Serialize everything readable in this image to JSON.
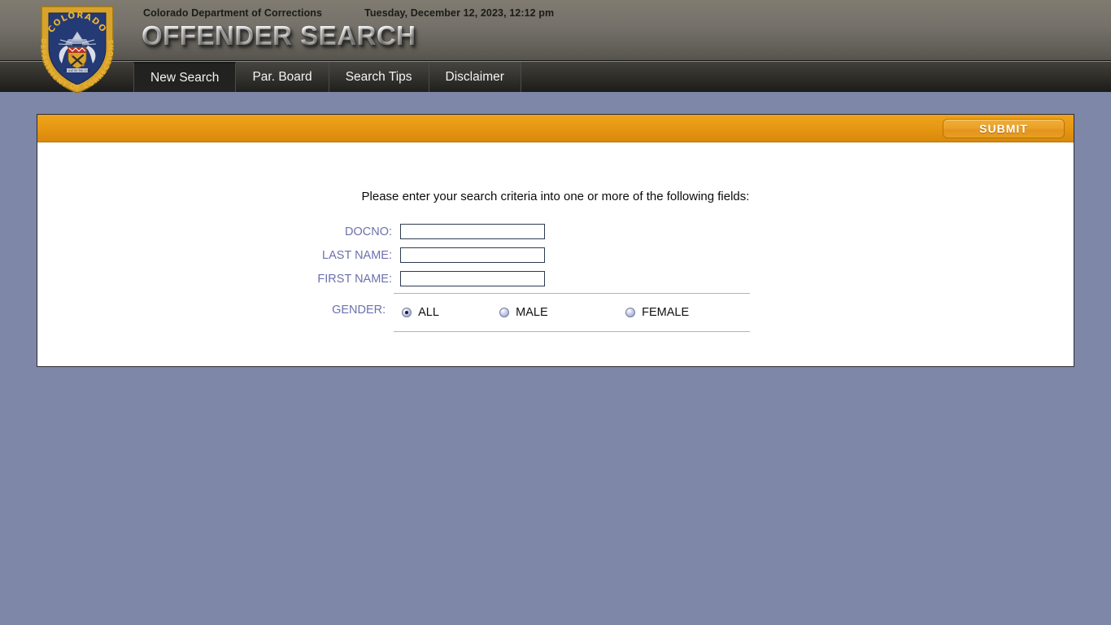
{
  "header": {
    "org": "Colorado Department of Corrections",
    "datetime": "Tuesday, December 12, 2023, 12:12 pm",
    "title": "OFFENDER SEARCH",
    "badge": {
      "top_text": "COLORADO",
      "arc_text": "DEPARTMENT OF CORRECTIONS",
      "motto": "WE LIVE BY THE CODE"
    }
  },
  "tabs": [
    {
      "label": "New Search",
      "active": true
    },
    {
      "label": "Par. Board",
      "active": false
    },
    {
      "label": "Search Tips",
      "active": false
    },
    {
      "label": "Disclaimer",
      "active": false
    }
  ],
  "toolbar": {
    "submit_label": "SUBMIT"
  },
  "main": {
    "instructions": "Please enter your search criteria into one or more of the following fields:",
    "fields": [
      {
        "label": "DOCNO:",
        "value": "",
        "placeholder": ""
      },
      {
        "label": "LAST NAME:",
        "value": "",
        "placeholder": ""
      },
      {
        "label": "FIRST NAME:",
        "value": "",
        "placeholder": ""
      }
    ],
    "gender": {
      "label": "GENDER:",
      "options": [
        {
          "label": "ALL",
          "selected": true
        },
        {
          "label": "MALE",
          "selected": false
        },
        {
          "label": "FEMALE",
          "selected": false
        }
      ]
    }
  },
  "colors": {
    "page_background": "#7f87a8",
    "header_top": "#807b70",
    "header_bottom": "#55534c",
    "tabbar": "#2f2e2a",
    "accent_orange": "#e08f0e",
    "label_blue": "#6d71ad",
    "panel_border": "#2b2b35"
  }
}
